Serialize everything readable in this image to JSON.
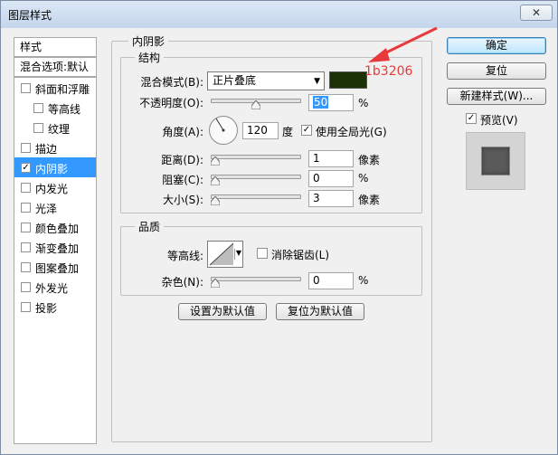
{
  "window": {
    "title": "图层样式",
    "close": "✕"
  },
  "left_panel": {
    "header": "样式",
    "blend_options": "混合选项:默认",
    "items": [
      {
        "label": "斜面和浮雕",
        "checked": false,
        "indent": false
      },
      {
        "label": "等高线",
        "checked": false,
        "indent": true
      },
      {
        "label": "纹理",
        "checked": false,
        "indent": true
      },
      {
        "label": "描边",
        "checked": false,
        "indent": false
      },
      {
        "label": "内阴影",
        "checked": true,
        "indent": false,
        "selected": true
      },
      {
        "label": "内发光",
        "checked": false,
        "indent": false
      },
      {
        "label": "光泽",
        "checked": false,
        "indent": false
      },
      {
        "label": "颜色叠加",
        "checked": false,
        "indent": false
      },
      {
        "label": "渐变叠加",
        "checked": false,
        "indent": false
      },
      {
        "label": "图案叠加",
        "checked": false,
        "indent": false
      },
      {
        "label": "外发光",
        "checked": false,
        "indent": false
      },
      {
        "label": "投影",
        "checked": false,
        "indent": false
      }
    ]
  },
  "panel": {
    "title": "内阴影",
    "structure": {
      "legend": "结构",
      "blend_mode_label": "混合模式(B):",
      "blend_mode_value": "正片叠底",
      "shadow_color": "#1b3206",
      "opacity_label": "不透明度(O):",
      "opacity_value": "50",
      "percent": "%",
      "angle_label": "角度(A):",
      "angle_value": "120",
      "degree": "度",
      "global_light_label": "使用全局光(G)",
      "global_light_checked": true,
      "distance_label": "距离(D):",
      "distance_value": "1",
      "choke_label": "阻塞(C):",
      "choke_value": "0",
      "size_label": "大小(S):",
      "size_value": "3",
      "pixels": "像素"
    },
    "quality": {
      "legend": "品质",
      "contour_label": "等高线:",
      "antialias_label": "消除锯齿(L)",
      "antialias_checked": false,
      "noise_label": "杂色(N):",
      "noise_value": "0",
      "percent": "%"
    },
    "buttons": {
      "set_default": "设置为默认值",
      "reset_default": "复位为默认值"
    }
  },
  "right_panel": {
    "ok": "确定",
    "reset": "复位",
    "new_style": "新建样式(W)...",
    "preview_label": "预览(V)",
    "preview_checked": true
  },
  "annotation": {
    "text": "1b3206",
    "color": "#e8393b"
  },
  "sliders": {
    "opacity": 0.5,
    "distance": 0.0,
    "choke": 0.0,
    "size": 0.0,
    "noise": 0.0
  }
}
